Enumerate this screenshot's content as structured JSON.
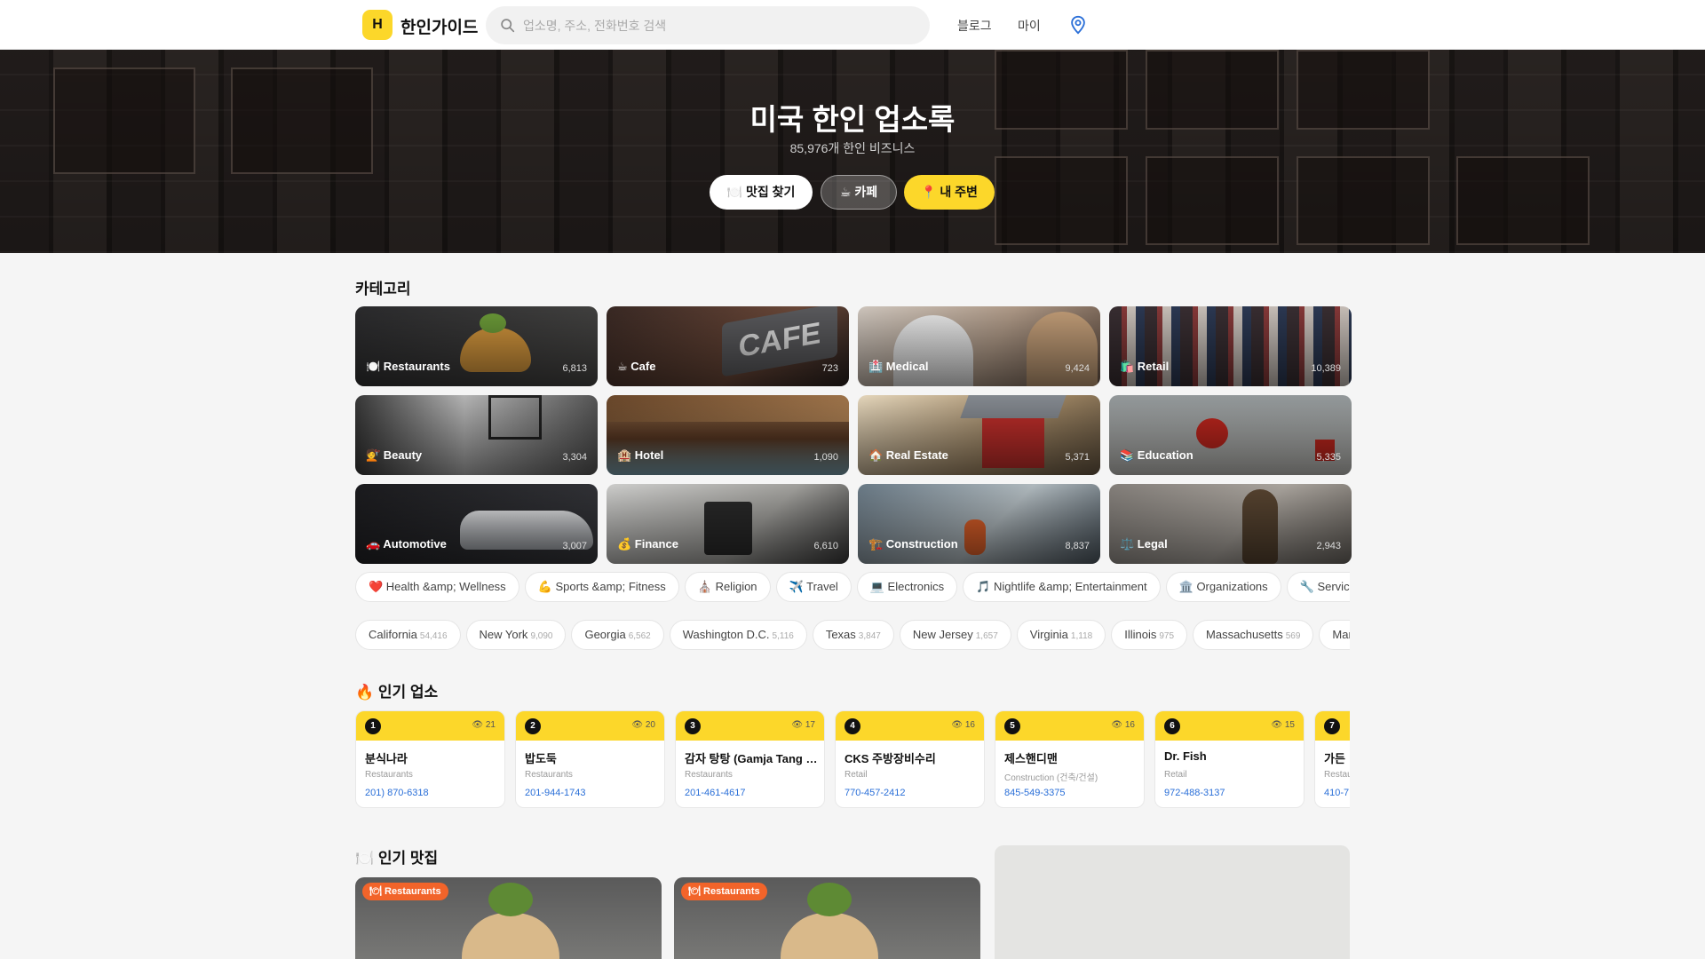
{
  "header": {
    "logo_mark": "H",
    "logo_text": "한인가이드",
    "search_placeholder": "업소명, 주소, 전화번호 검색",
    "nav": [
      "블로그",
      "마이"
    ]
  },
  "hero": {
    "title": "미국 한인 업소록",
    "subtitle": "85,976개 한인 비즈니스",
    "buttons": [
      "🍽️ 맛집 찾기",
      "☕ 카페",
      "📍 내 주변"
    ]
  },
  "categories": {
    "title": "카테고리",
    "items": [
      {
        "label": "🍽️ Restaurants",
        "count": "6,813"
      },
      {
        "label": "☕ Cafe",
        "count": "723"
      },
      {
        "label": "🏥 Medical",
        "count": "9,424"
      },
      {
        "label": "🛍️ Retail",
        "count": "10,389"
      },
      {
        "label": "💇 Beauty",
        "count": "3,304"
      },
      {
        "label": "🏨 Hotel",
        "count": "1,090"
      },
      {
        "label": "🏠 Real Estate",
        "count": "5,371"
      },
      {
        "label": "📚 Education",
        "count": "5,335"
      },
      {
        "label": "🚗 Automotive",
        "count": "3,007"
      },
      {
        "label": "💰 Finance",
        "count": "6,610"
      },
      {
        "label": "🏗️ Construction",
        "count": "8,837"
      },
      {
        "label": "⚖️ Legal",
        "count": "2,943"
      }
    ],
    "subcategories": [
      "❤️ Health &amp; Wellness",
      "💪 Sports &amp; Fitness",
      "⛪ Religion",
      "✈️ Travel",
      "💻 Electronics",
      "🎵 Nightlife &amp; Entertainment",
      "🏛️ Organizations",
      "🔧 Services"
    ]
  },
  "states": [
    {
      "name": "California",
      "count": "54,416"
    },
    {
      "name": "New York",
      "count": "9,090"
    },
    {
      "name": "Georgia",
      "count": "6,562"
    },
    {
      "name": "Washington D.C.",
      "count": "5,116"
    },
    {
      "name": "Texas",
      "count": "3,847"
    },
    {
      "name": "New Jersey",
      "count": "1,657"
    },
    {
      "name": "Virginia",
      "count": "1,118"
    },
    {
      "name": "Illinois",
      "count": "975"
    },
    {
      "name": "Massachusetts",
      "count": "569"
    },
    {
      "name": "Maryland",
      "count": ""
    }
  ],
  "popular": {
    "title": "🔥 인기 업소",
    "items": [
      {
        "rank": "1",
        "views": "👁 21",
        "name": "분식나라",
        "category": "Restaurants",
        "phone": "201) 870-6318"
      },
      {
        "rank": "2",
        "views": "👁 20",
        "name": "밥도둑",
        "category": "Restaurants",
        "phone": "201-944-1743"
      },
      {
        "rank": "3",
        "views": "👁 17",
        "name": "감자 탕탕 (Gamja Tang Tang)",
        "category": "Restaurants",
        "phone": "201-461-4617"
      },
      {
        "rank": "4",
        "views": "👁 16",
        "name": "CKS 주방장비수리",
        "category": "Retail",
        "phone": "770-457-2412"
      },
      {
        "rank": "5",
        "views": "👁 16",
        "name": "제스핸디맨",
        "category": "Construction (건축/건설)",
        "phone": "845-549-3375"
      },
      {
        "rank": "6",
        "views": "👁 15",
        "name": "Dr. Fish",
        "category": "Retail",
        "phone": "972-488-3137"
      },
      {
        "rank": "7",
        "views": "",
        "name": "가든",
        "category": "Restaurants",
        "phone": "410-7"
      }
    ]
  },
  "restaurants": {
    "title": "🍽️ 인기 맛집",
    "tags": [
      "🍽 Restaurants",
      "🍽 Restaurants"
    ]
  },
  "colors": {
    "brand_yellow": "#fcd72a",
    "phone_blue": "#2a6fd8",
    "tag_orange": "#f2642a"
  }
}
